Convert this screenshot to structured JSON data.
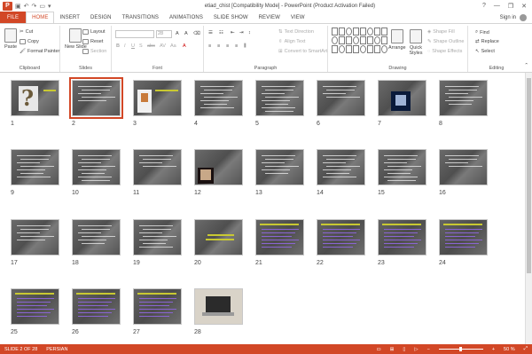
{
  "window": {
    "title": "etiad_chist [Compatibility Mode] - PowerPoint (Product Activation Failed)",
    "controls": [
      "?",
      "—",
      "❐",
      "✕"
    ]
  },
  "tabs": [
    {
      "label": "FILE",
      "kind": "file"
    },
    {
      "label": "HOME",
      "kind": "active"
    },
    {
      "label": "INSERT"
    },
    {
      "label": "DESIGN"
    },
    {
      "label": "TRANSITIONS"
    },
    {
      "label": "ANIMATIONS"
    },
    {
      "label": "SLIDE SHOW"
    },
    {
      "label": "REVIEW"
    },
    {
      "label": "VIEW"
    }
  ],
  "signin": "Sign in",
  "ribbon": {
    "clipboard": {
      "paste": "Paste",
      "cut": "Cut",
      "copy": "Copy",
      "format_painter": "Format Painter",
      "label": "Clipboard"
    },
    "slides": {
      "new_slide": "New Slide",
      "layout": "Layout",
      "reset": "Reset",
      "section": "Section",
      "label": "Slides"
    },
    "font": {
      "size": "28",
      "label": "Font"
    },
    "paragraph": {
      "text_direction": "Text Direction",
      "align_text": "Align Text",
      "convert_smartart": "Convert to SmartArt",
      "label": "Paragraph"
    },
    "drawing": {
      "arrange": "Arrange",
      "quick_styles": "Quick Styles",
      "shape_fill": "Shape Fill",
      "shape_outline": "Shape Outline",
      "shape_effects": "Shape Effects",
      "label": "Drawing"
    },
    "editing": {
      "find": "Find",
      "replace": "Replace",
      "select": "Select",
      "label": "Editing"
    }
  },
  "slides": [
    {
      "n": "1",
      "kind": "question"
    },
    {
      "n": "2",
      "kind": "text",
      "selected": true
    },
    {
      "n": "3",
      "kind": "person"
    },
    {
      "n": "4",
      "kind": "text"
    },
    {
      "n": "5",
      "kind": "text"
    },
    {
      "n": "6",
      "kind": "text"
    },
    {
      "n": "7",
      "kind": "brain"
    },
    {
      "n": "8",
      "kind": "text"
    },
    {
      "n": "9",
      "kind": "text"
    },
    {
      "n": "10",
      "kind": "text"
    },
    {
      "n": "11",
      "kind": "text"
    },
    {
      "n": "12",
      "kind": "skull"
    },
    {
      "n": "13",
      "kind": "text"
    },
    {
      "n": "14",
      "kind": "text"
    },
    {
      "n": "15",
      "kind": "text"
    },
    {
      "n": "16",
      "kind": "text"
    },
    {
      "n": "17",
      "kind": "text"
    },
    {
      "n": "18",
      "kind": "text"
    },
    {
      "n": "19",
      "kind": "text"
    },
    {
      "n": "20",
      "kind": "title"
    },
    {
      "n": "21",
      "kind": "purple"
    },
    {
      "n": "22",
      "kind": "purple"
    },
    {
      "n": "23",
      "kind": "purple"
    },
    {
      "n": "24",
      "kind": "purple"
    },
    {
      "n": "25",
      "kind": "purple"
    },
    {
      "n": "26",
      "kind": "purple"
    },
    {
      "n": "27",
      "kind": "purple"
    },
    {
      "n": "28",
      "kind": "laptop"
    }
  ],
  "status": {
    "slide_count": "SLIDE 2 OF 28",
    "language": "PERSIAN",
    "zoom": "50 %"
  },
  "colors": {
    "accent": "#d24726",
    "purple_text": "#8a64d2",
    "yellow_text": "#c8c832"
  }
}
